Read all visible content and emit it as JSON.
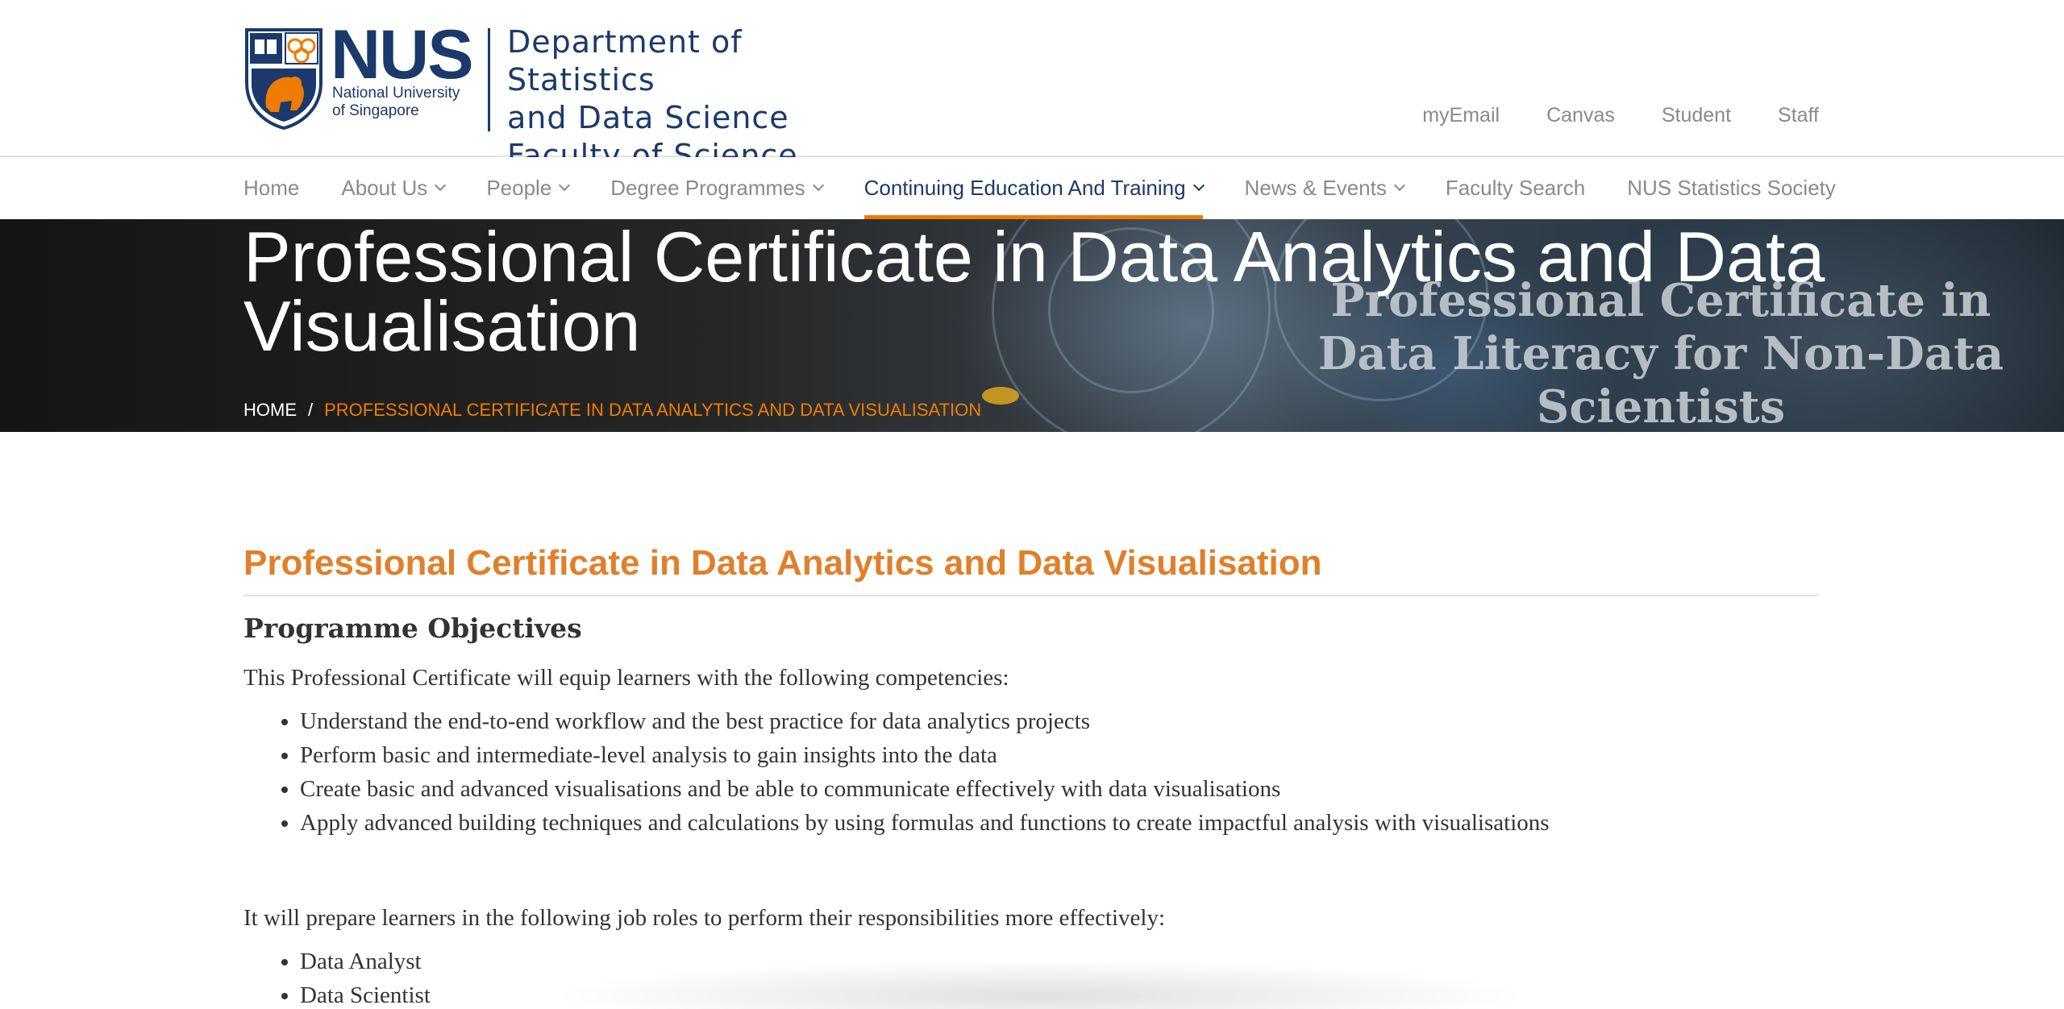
{
  "logo": {
    "wordmark": "NUS",
    "subtitle_line1": "National University",
    "subtitle_line2": "of Singapore",
    "dept_line1": "Department of Statistics",
    "dept_line2": "and Data Science",
    "dept_line3": "Faculty of Science"
  },
  "utility_links": [
    "myEmail",
    "Canvas",
    "Student",
    "Staff"
  ],
  "nav": {
    "items": [
      {
        "label": "Home",
        "dropdown": false
      },
      {
        "label": "About Us",
        "dropdown": true
      },
      {
        "label": "People",
        "dropdown": true
      },
      {
        "label": "Degree Programmes",
        "dropdown": true
      },
      {
        "label": "Continuing Education And Training",
        "dropdown": true,
        "active": true
      },
      {
        "label": "News & Events",
        "dropdown": true
      },
      {
        "label": "Faculty Search",
        "dropdown": false
      },
      {
        "label": "NUS Statistics Society",
        "dropdown": false
      }
    ]
  },
  "banner": {
    "title": "Professional Certificate in Data Analytics and Data Visualisation",
    "image_text": "Professional Certificate in Data Literacy for Non-Data Scientists",
    "breadcrumb_home": "HOME",
    "breadcrumb_sep": "/",
    "breadcrumb_current": "PROFESSIONAL CERTIFICATE IN DATA ANALYTICS AND DATA VISUALISATION"
  },
  "content": {
    "heading": "Professional Certificate in Data Analytics and Data Visualisation",
    "section_title": "Programme Objectives",
    "intro": "This Professional Certificate will equip learners with the following competencies:",
    "competencies": [
      "Understand the end-to-end workflow and the best practice for data analytics projects",
      "Perform basic and intermediate-level analysis to gain insights into the data",
      "Create basic and advanced visualisations and be able to communicate effectively with data visualisations",
      "Apply advanced building techniques and calculations by using formulas and functions to create impactful analysis with visualisations"
    ],
    "roles_intro": "It will prepare learners in the following job roles to perform their responsibilities more effectively:",
    "roles": [
      "Data Analyst",
      "Data Scientist"
    ]
  },
  "colors": {
    "brand_blue": "#1b3a6b",
    "accent_orange": "#ef7c00",
    "heading_orange": "#e0802a"
  }
}
